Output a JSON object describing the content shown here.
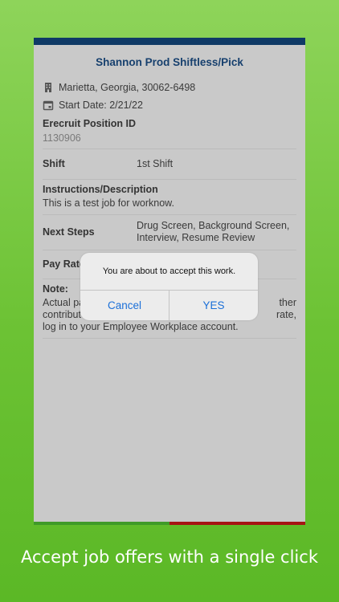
{
  "job": {
    "title": "Shannon Prod Shiftless/Pick",
    "location": "Marietta, Georgia, 30062-6498",
    "start_date": "Start Date: 2/21/22"
  },
  "fields": {
    "position_id_label": "Erecruit Position ID",
    "position_id_value": "1130906",
    "shift_label": "Shift",
    "shift_value": "1st Shift",
    "instructions_label": "Instructions/Description",
    "instructions_value": "This is a test job for worknow.",
    "next_steps_label": "Next Steps",
    "next_steps_value": "Drug Screen, Background Screen, Interview, Resume Review",
    "pay_rate_label": "Pay Rate",
    "note_label": "Note:",
    "note_value_line1": "Actual pa",
    "note_value_line1_right": "ther",
    "note_value_line2": "contribut",
    "note_value_line2_right": "rate,",
    "note_value_line3": "log in to your Employee Workplace account."
  },
  "dialog": {
    "message": "You are about to accept this work.",
    "cancel_label": "Cancel",
    "yes_label": "YES"
  },
  "caption": "Accept job offers with a single click",
  "colors": {
    "header_bar": "#0f3a66",
    "title": "#17406e",
    "dialog_button": "#1a6fd8",
    "bottom_left_bar": "#3f9a28",
    "bottom_right_bar": "#a51414"
  },
  "icons": {
    "location": "building-icon",
    "start_date": "calendar-icon"
  }
}
